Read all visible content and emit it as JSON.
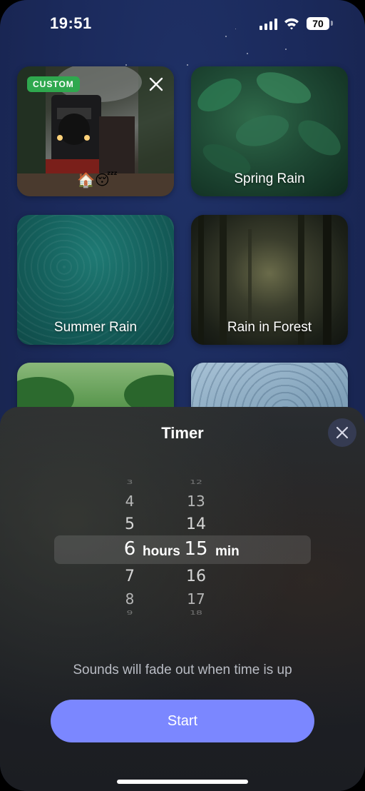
{
  "status": {
    "time": "19:51",
    "battery": "70"
  },
  "cards": [
    {
      "label": "",
      "badge": "CUSTOM",
      "emojis": "🏠😴"
    },
    {
      "label": "Spring Rain"
    },
    {
      "label": "Summer Rain"
    },
    {
      "label": "Rain in Forest"
    },
    {
      "label": ""
    },
    {
      "label": ""
    }
  ],
  "timer": {
    "title": "Timer",
    "hours_values": [
      "3",
      "4",
      "5",
      "6",
      "7",
      "8",
      "9"
    ],
    "minutes_values": [
      "12",
      "13",
      "14",
      "15",
      "16",
      "17",
      "18"
    ],
    "selected_hours": "6",
    "selected_minutes": "15",
    "hours_unit": "hours",
    "minutes_unit": "min",
    "note": "Sounds will fade out when time is up",
    "start_label": "Start"
  },
  "colors": {
    "accent": "#7b87ff",
    "badge": "#2fa84e",
    "background": "#1b2a5c"
  }
}
